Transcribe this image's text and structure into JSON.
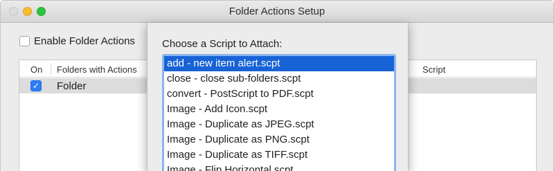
{
  "window": {
    "title": "Folder Actions Setup"
  },
  "main": {
    "enable_label": "Enable Folder Actions",
    "enable_checked": false,
    "table": {
      "columns": [
        "On",
        "Folders with Actions",
        "Script"
      ],
      "script_column_visible_text": "Script",
      "rows": [
        {
          "on": true,
          "folder": "Folder"
        }
      ]
    }
  },
  "sheet": {
    "heading": "Choose a Script to Attach:",
    "selected_index": 0,
    "scripts": [
      "add - new item alert.scpt",
      "close - close sub-folders.scpt",
      "convert - PostScript to PDF.scpt",
      "Image - Add Icon.scpt",
      "Image - Duplicate as JPEG.scpt",
      "Image - Duplicate as PNG.scpt",
      "Image - Duplicate as TIFF.scpt",
      "Image - Flip Horizontal.scpt"
    ]
  },
  "colors": {
    "selection": "#1763d6",
    "checkbox_checked": "#2f7cf6",
    "focus_ring": "#8bb5ee"
  }
}
